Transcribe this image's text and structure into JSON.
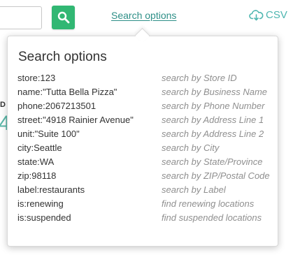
{
  "header": {
    "search_input_value": "",
    "search_options_label": "Search options",
    "csv_label": "CSV"
  },
  "background": {
    "label_fragment": "D",
    "number_fragment": "4"
  },
  "popover": {
    "title": "Search options",
    "options": [
      {
        "key": "store:123",
        "description": "search by Store ID"
      },
      {
        "key": "name:\"Tutta Bella Pizza\"",
        "description": "search by Business Name"
      },
      {
        "key": "phone:2067213501",
        "description": "search by Phone Number"
      },
      {
        "key": "street:\"4918 Rainier Avenue\"",
        "description": "search by Address Line 1"
      },
      {
        "key": "unit:\"Suite 100\"",
        "description": "search by Address Line 2"
      },
      {
        "key": "city:Seattle",
        "description": "search by City"
      },
      {
        "key": "state:WA",
        "description": "search by State/Province"
      },
      {
        "key": "zip:98118",
        "description": "search by ZIP/Postal Code"
      },
      {
        "key": "label:restaurants",
        "description": "search by Label"
      },
      {
        "key": "is:renewing",
        "description": "find renewing locations"
      },
      {
        "key": "is:suspended",
        "description": "find suspended locations"
      }
    ]
  },
  "colors": {
    "search_button": "#31b773",
    "link": "#2d8f87",
    "csv": "#4eb6b0"
  },
  "icons": {
    "search_button_icon": "search-icon",
    "csv_icon": "cloud-download-icon"
  }
}
